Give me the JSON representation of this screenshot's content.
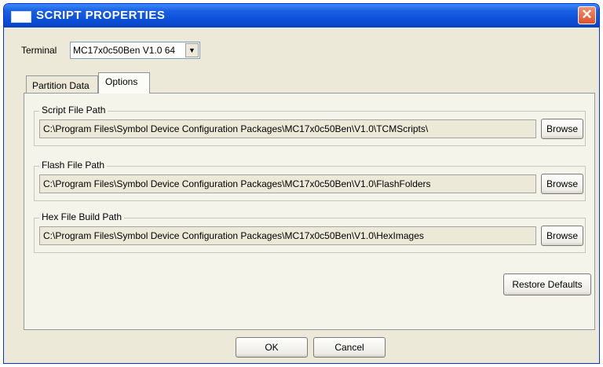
{
  "window": {
    "title": "SCRIPT PROPERTIES",
    "close_glyph": "✕"
  },
  "terminal": {
    "label": "Terminal",
    "value": "MC17x0c50Ben V1.0 64",
    "arrow_glyph": "▼"
  },
  "tabs": [
    {
      "label": "Partition Data"
    },
    {
      "label": "Options"
    }
  ],
  "groups": {
    "script": {
      "legend": "Script File Path",
      "path": "C:\\Program Files\\Symbol Device Configuration Packages\\MC17x0c50Ben\\V1.0\\TCMScripts\\",
      "button": "Browse"
    },
    "flash": {
      "legend": "Flash File Path",
      "path": "C:\\Program Files\\Symbol Device Configuration Packages\\MC17x0c50Ben\\V1.0\\FlashFolders",
      "button": "Browse"
    },
    "hex": {
      "legend": "Hex File Build Path",
      "path": "C:\\Program Files\\Symbol Device Configuration Packages\\MC17x0c50Ben\\V1.0\\HexImages",
      "button": "Browse"
    }
  },
  "buttons": {
    "restore_defaults": "Restore Defaults",
    "ok": "OK",
    "cancel": "Cancel"
  },
  "icons": {
    "title": "window-icon",
    "close": "close-icon",
    "dropdown": "chevron-down-icon"
  },
  "colors": {
    "titlebar": "#0a4fd8",
    "close_button": "#d9532c",
    "dialog_bg": "#ece9d8"
  }
}
